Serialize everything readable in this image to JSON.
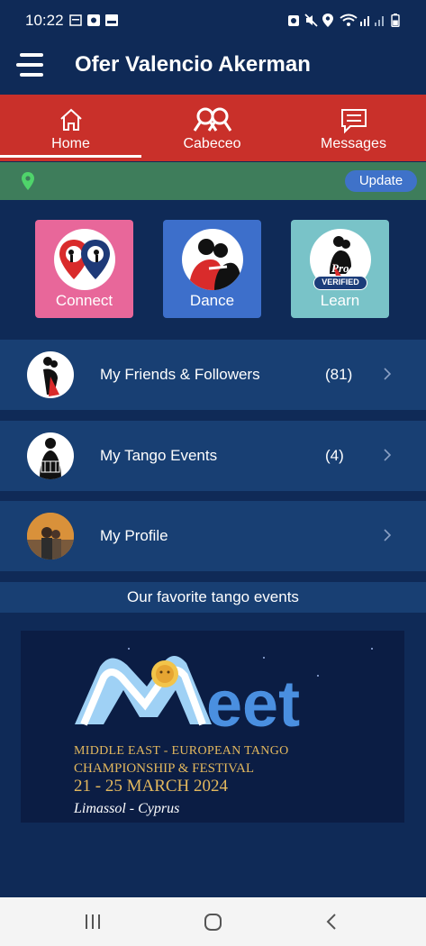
{
  "status_bar": {
    "time": "10:22",
    "left_icons": [
      "image-icon",
      "camera-icon",
      "photo-icon"
    ],
    "right_icons": [
      "alarm-icon",
      "mute-icon",
      "location-icon",
      "wifi-icon",
      "signal-icon",
      "battery-icon"
    ]
  },
  "app_bar": {
    "title": "Ofer Valencio Akerman",
    "menu_icon": "hamburger-menu-icon"
  },
  "tabs": [
    {
      "label": "Home",
      "icon": "home-icon",
      "active": true
    },
    {
      "label": "Cabeceo",
      "icon": "cabeceo-icon",
      "active": false
    },
    {
      "label": "Messages",
      "icon": "messages-icon",
      "active": false
    }
  ],
  "update_bar": {
    "icon": "location-pin-icon",
    "button_label": "Update"
  },
  "quick_actions": [
    {
      "label": "Connect",
      "color": "#e8679a"
    },
    {
      "label": "Dance",
      "color": "#3d6fcb"
    },
    {
      "label": "Learn",
      "color": "#79c3c8",
      "badge_top": "Pro",
      "badge": "VERIFIED"
    }
  ],
  "menu_rows": [
    {
      "label": "My Friends & Followers",
      "count": "(81)"
    },
    {
      "label": "My Tango Events",
      "count": "(4)"
    },
    {
      "label": "My Profile",
      "count": ""
    }
  ],
  "favorites": {
    "heading": "Our favorite tango events",
    "banner": {
      "logo_text": "eet",
      "line1": "MIDDLE EAST - EUROPEAN TANGO",
      "line2": "CHAMPIONSHIP & FESTIVAL",
      "line3": "21 - 25 MARCH 2024",
      "line4": "Limassol - Cyprus"
    }
  },
  "nav_bar": {
    "icons": [
      "recent-apps-icon",
      "home-circle-icon",
      "back-icon"
    ]
  },
  "colors": {
    "background": "#0f2a57",
    "tab_bar": "#c9302a",
    "update_bar": "#3e7d5b",
    "row": "#183f73"
  }
}
